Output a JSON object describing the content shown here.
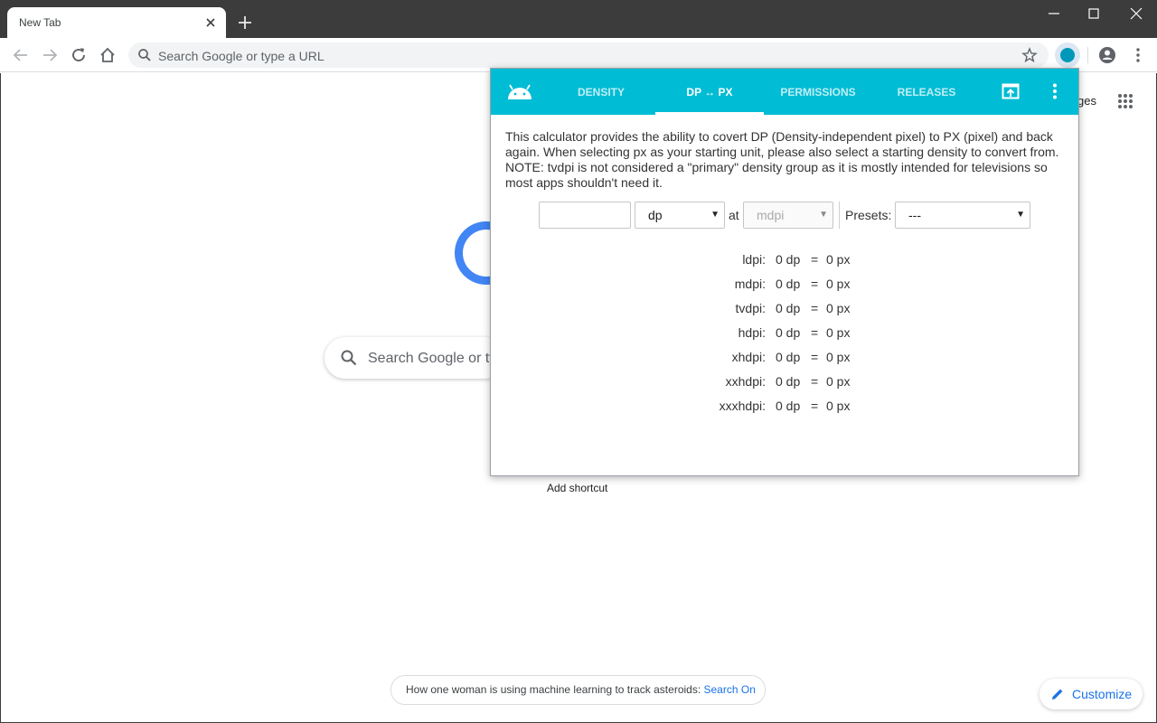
{
  "browser": {
    "tab_title": "New Tab",
    "omnibox_placeholder": "Search Google or type a URL"
  },
  "ntp": {
    "images_link": "ges",
    "search_placeholder": "Search Google or ty",
    "add_shortcut": "Add shortcut",
    "promo_text": "How one woman is using machine learning to track asteroids: ",
    "promo_link": "Search On",
    "customize_label": "Customize"
  },
  "popup": {
    "tabs": [
      {
        "label": "DENSITY"
      },
      {
        "label": "DP ↔ PX"
      },
      {
        "label": "PERMISSIONS"
      },
      {
        "label": "RELEASES"
      }
    ],
    "active_tab": 1,
    "description": "This calculator provides the ability to covert DP (Density-independent pixel) to PX (pixel) and back again. When selecting px as your starting unit, please also select a starting density to convert from. NOTE: tvdpi is not considered a \"primary\" density group as it is mostly intended for televisions so most apps shouldn't need it.",
    "value_input": "",
    "unit_select": "dp",
    "at_label": "at",
    "density_select": "mdpi",
    "presets_label": "Presets:",
    "presets_select": "---",
    "results": [
      {
        "density": "ldpi:",
        "dp": "0 dp",
        "eq": "=",
        "px": "0 px"
      },
      {
        "density": "mdpi:",
        "dp": "0 dp",
        "eq": "=",
        "px": "0 px"
      },
      {
        "density": "tvdpi:",
        "dp": "0 dp",
        "eq": "=",
        "px": "0 px"
      },
      {
        "density": "hdpi:",
        "dp": "0 dp",
        "eq": "=",
        "px": "0 px"
      },
      {
        "density": "xhdpi:",
        "dp": "0 dp",
        "eq": "=",
        "px": "0 px"
      },
      {
        "density": "xxhdpi:",
        "dp": "0 dp",
        "eq": "=",
        "px": "0 px"
      },
      {
        "density": "xxxhdpi:",
        "dp": "0 dp",
        "eq": "=",
        "px": "0 px"
      }
    ]
  },
  "colors": {
    "popup_header": "#00bcd4",
    "accent_blue": "#1a73e8",
    "titlebar": "#3c3c3c"
  }
}
